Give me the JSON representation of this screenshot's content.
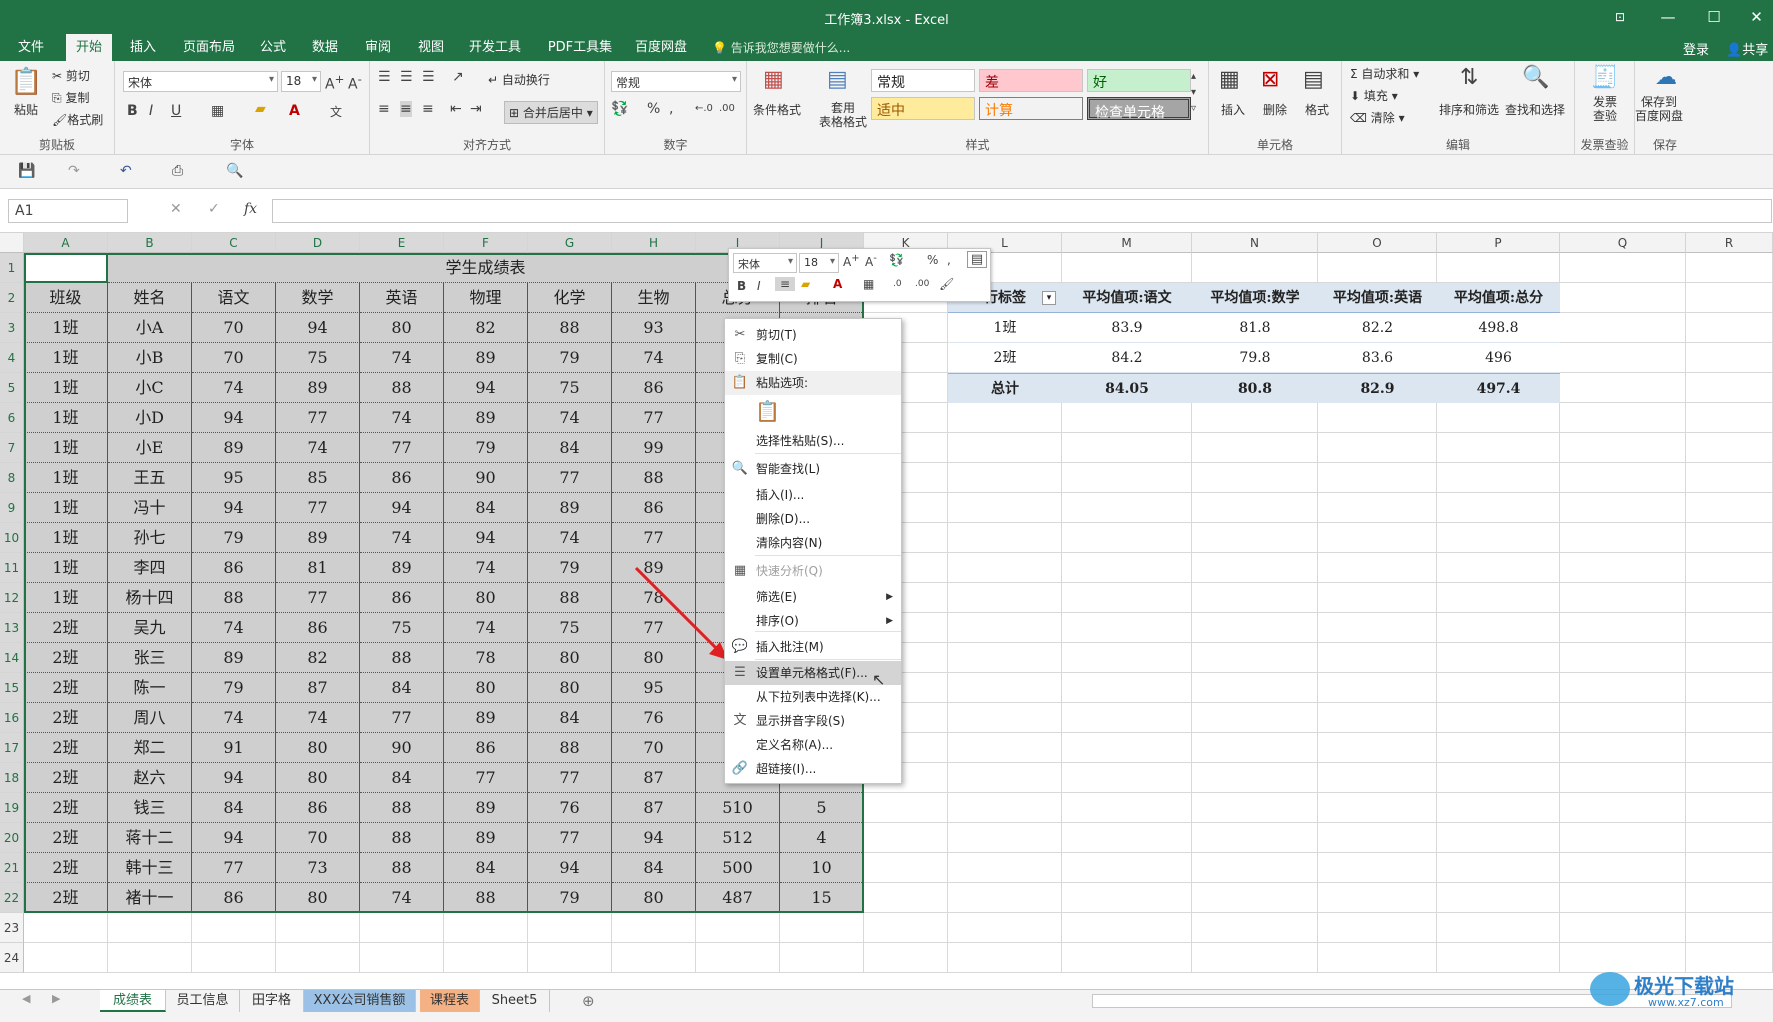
{
  "window": {
    "title": "工作簿3.xlsx - Excel",
    "ribbon_display_icon": "ribbon-display-icon",
    "minimize": "—",
    "maximize": "☐",
    "close": "✕"
  },
  "tabs": [
    "文件",
    "开始",
    "插入",
    "页面布局",
    "公式",
    "数据",
    "审阅",
    "视图",
    "开发工具",
    "PDF工具集",
    "百度网盘"
  ],
  "active_tab": "开始",
  "tell_me": "告诉我您想要做什么...",
  "account": {
    "login": "登录",
    "share": "共享"
  },
  "ribbon": {
    "clipboard": {
      "paste": "粘贴",
      "cut": "剪切",
      "copy": "复制",
      "painter": "格式刷",
      "label": "剪贴板"
    },
    "font": {
      "name": "宋体",
      "size": "18",
      "bold": "B",
      "italic": "I",
      "underline": "U",
      "label": "字体"
    },
    "align": {
      "wrap": "自动换行",
      "merge": "合并后居中",
      "label": "对齐方式"
    },
    "number": {
      "format": "常规",
      "percent": "%",
      "comma": ",",
      "label": "数字"
    },
    "styles": {
      "cond": "条件格式",
      "table": "套用\n表格格式",
      "normal": "常规",
      "bad": "差",
      "good": "好",
      "neutral": "适中",
      "calc": "计算",
      "check": "检查单元格",
      "label": "样式"
    },
    "cells": {
      "insert": "插入",
      "delete": "删除",
      "format": "格式",
      "label": "单元格"
    },
    "editing": {
      "autosum": "自动求和",
      "fill": "填充",
      "clear": "清除",
      "sort": "排序和筛选",
      "find": "查找和选择",
      "label": "编辑"
    },
    "invoice": {
      "check": "发票\n查验",
      "label": "发票查验"
    },
    "save": {
      "baidu": "保存到\n百度网盘",
      "label": "保存"
    }
  },
  "namebox": "A1",
  "columns": [
    "A",
    "B",
    "C",
    "D",
    "E",
    "F",
    "G",
    "H",
    "I",
    "J",
    "K",
    "L",
    "M",
    "N",
    "O",
    "P",
    "Q",
    "R"
  ],
  "rows": [
    "1",
    "2",
    "3",
    "4",
    "5",
    "6",
    "7",
    "8",
    "9",
    "10",
    "11",
    "12",
    "13",
    "14",
    "15",
    "16",
    "17",
    "18",
    "19",
    "20",
    "21",
    "22",
    "23",
    "24"
  ],
  "table": {
    "title": "学生成绩表",
    "headers": [
      "班级",
      "姓名",
      "语文",
      "数学",
      "英语",
      "物理",
      "化学",
      "生物",
      "总分",
      "排名"
    ],
    "rows": [
      [
        "1班",
        "小A",
        "70",
        "94",
        "80",
        "82",
        "88",
        "93",
        "",
        ""
      ],
      [
        "1班",
        "小B",
        "70",
        "75",
        "74",
        "89",
        "79",
        "74",
        "",
        ""
      ],
      [
        "1班",
        "小C",
        "74",
        "89",
        "88",
        "94",
        "75",
        "86",
        "",
        ""
      ],
      [
        "1班",
        "小D",
        "94",
        "77",
        "74",
        "89",
        "74",
        "77",
        "",
        ""
      ],
      [
        "1班",
        "小E",
        "89",
        "74",
        "77",
        "79",
        "84",
        "99",
        "",
        ""
      ],
      [
        "1班",
        "王五",
        "95",
        "85",
        "86",
        "90",
        "77",
        "88",
        "",
        ""
      ],
      [
        "1班",
        "冯十",
        "94",
        "77",
        "94",
        "84",
        "89",
        "86",
        "",
        ""
      ],
      [
        "1班",
        "孙七",
        "79",
        "89",
        "74",
        "94",
        "74",
        "77",
        "",
        ""
      ],
      [
        "1班",
        "李四",
        "86",
        "81",
        "89",
        "74",
        "79",
        "89",
        "",
        ""
      ],
      [
        "1班",
        "杨十四",
        "88",
        "77",
        "86",
        "80",
        "88",
        "78",
        "",
        ""
      ],
      [
        "2班",
        "吴九",
        "74",
        "86",
        "75",
        "74",
        "75",
        "77",
        "",
        ""
      ],
      [
        "2班",
        "张三",
        "89",
        "82",
        "88",
        "78",
        "80",
        "80",
        "",
        ""
      ],
      [
        "2班",
        "陈一",
        "79",
        "87",
        "84",
        "80",
        "80",
        "95",
        "",
        ""
      ],
      [
        "2班",
        "周八",
        "74",
        "74",
        "77",
        "89",
        "84",
        "76",
        "",
        ""
      ],
      [
        "2班",
        "郑二",
        "91",
        "80",
        "90",
        "86",
        "88",
        "70",
        "",
        ""
      ],
      [
        "2班",
        "赵六",
        "94",
        "80",
        "84",
        "77",
        "77",
        "87",
        "",
        ""
      ],
      [
        "2班",
        "钱三",
        "84",
        "86",
        "88",
        "89",
        "76",
        "87",
        "510",
        "5"
      ],
      [
        "2班",
        "蒋十二",
        "94",
        "70",
        "88",
        "89",
        "77",
        "94",
        "512",
        "4"
      ],
      [
        "2班",
        "韩十三",
        "77",
        "73",
        "88",
        "84",
        "94",
        "84",
        "500",
        "10"
      ],
      [
        "2班",
        "褚十一",
        "86",
        "80",
        "74",
        "88",
        "79",
        "80",
        "487",
        "15"
      ]
    ]
  },
  "pivot": {
    "headers": [
      "行标签",
      "平均值项:语文",
      "平均值项:数学",
      "平均值项:英语",
      "平均值项:总分"
    ],
    "rows": [
      [
        "1班",
        "83.9",
        "81.8",
        "82.2",
        "498.8"
      ],
      [
        "2班",
        "84.2",
        "79.8",
        "83.6",
        "496"
      ]
    ],
    "total": [
      "总计",
      "84.05",
      "80.8",
      "82.9",
      "497.4"
    ]
  },
  "mini_toolbar": {
    "font": "宋体",
    "size": "18",
    "bold": "B",
    "italic": "I"
  },
  "context_menu": [
    {
      "label": "剪切(T)",
      "icon": "✂"
    },
    {
      "label": "复制(C)",
      "icon": "⎘"
    },
    {
      "label": "粘贴选项:",
      "icon": "📋"
    },
    {
      "label": "选择性粘贴(S)...",
      "icon": ""
    },
    {
      "label": "智能查找(L)",
      "icon": "🔍"
    },
    {
      "label": "插入(I)...",
      "icon": ""
    },
    {
      "label": "删除(D)...",
      "icon": ""
    },
    {
      "label": "清除内容(N)",
      "icon": ""
    },
    {
      "label": "快速分析(Q)",
      "icon": "▦"
    },
    {
      "label": "筛选(E)",
      "icon": ""
    },
    {
      "label": "排序(O)",
      "icon": ""
    },
    {
      "label": "插入批注(M)",
      "icon": "💬"
    },
    {
      "label": "设置单元格格式(F)...",
      "icon": "☰"
    },
    {
      "label": "从下拉列表中选择(K)...",
      "icon": ""
    },
    {
      "label": "显示拼音字段(S)",
      "icon": "文"
    },
    {
      "label": "定义名称(A)...",
      "icon": ""
    },
    {
      "label": "超链接(I)...",
      "icon": "🔗"
    }
  ],
  "sheets": [
    "成绩表",
    "员工信息",
    "田字格",
    "XXX公司销售额",
    "课程表",
    "Sheet5"
  ],
  "active_sheet": "成绩表",
  "watermark": "极光下载站",
  "watermark_url": "www.xz7.com",
  "colors": {
    "excel_green": "#217346",
    "selection_gray": "#cfcfcf",
    "pivot_header": "#dce6f1",
    "arrow_red": "#e02020",
    "sheet_blue": "#9bc2e6",
    "sheet_orange": "#f4b183"
  }
}
